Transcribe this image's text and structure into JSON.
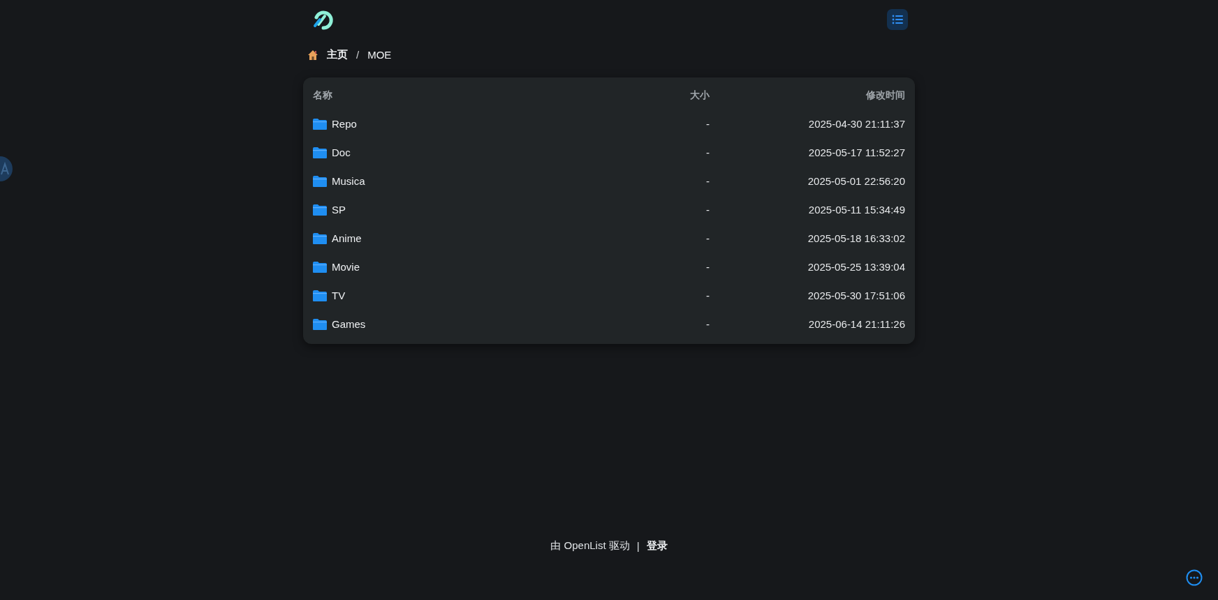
{
  "breadcrumb": [
    {
      "label": "主页",
      "kind": "home"
    },
    {
      "label": "MOE",
      "kind": "plain"
    }
  ],
  "breadcrumb_separator": "/",
  "table": {
    "columns": [
      "名称",
      "大小",
      "修改时间"
    ],
    "rows": [
      {
        "name": "Repo",
        "size": "-",
        "modified": "2025-04-30 21:11:37"
      },
      {
        "name": "Doc",
        "size": "-",
        "modified": "2025-05-17 11:52:27"
      },
      {
        "name": "Musica",
        "size": "-",
        "modified": "2025-05-01 22:56:20"
      },
      {
        "name": "SP",
        "size": "-",
        "modified": "2025-05-11 15:34:49"
      },
      {
        "name": "Anime",
        "size": "-",
        "modified": "2025-05-18 16:33:02"
      },
      {
        "name": "Movie",
        "size": "-",
        "modified": "2025-05-25 13:39:04"
      },
      {
        "name": "TV",
        "size": "-",
        "modified": "2025-05-30 17:51:06"
      },
      {
        "name": "Games",
        "size": "-",
        "modified": "2025-06-14 21:11:26"
      }
    ]
  },
  "footer": {
    "powered_by": "由 OpenList 驱动",
    "separator": "|",
    "login": "登录"
  }
}
